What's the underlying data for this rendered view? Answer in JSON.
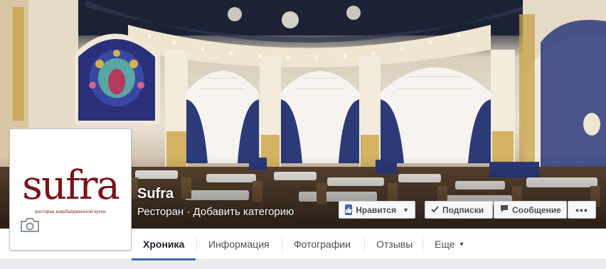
{
  "page": {
    "name": "Sufra",
    "category": "Ресторан · Добавить категорию"
  },
  "logo": {
    "word": "sufra",
    "tagline": "ресторан азербайджанской кухни"
  },
  "actions": {
    "like_label": "Нравится",
    "follow_label": "Подписки",
    "message_label": "Сообщение",
    "more_label": "•••"
  },
  "tabs": [
    {
      "label": "Хроника",
      "active": true
    },
    {
      "label": "Информация",
      "active": false
    },
    {
      "label": "Фотографии",
      "active": false
    },
    {
      "label": "Отзывы",
      "active": false
    },
    {
      "label": "Еще",
      "active": false
    }
  ],
  "colors": {
    "brand_blue": "#4267b2",
    "logo_red": "#7a1417",
    "tab_active_text": "#1d2129"
  },
  "icons": [
    "thumbs-up-icon",
    "checkmark-icon",
    "message-bubble-icon",
    "ellipsis-icon",
    "camera-icon",
    "caret-down-icon"
  ]
}
